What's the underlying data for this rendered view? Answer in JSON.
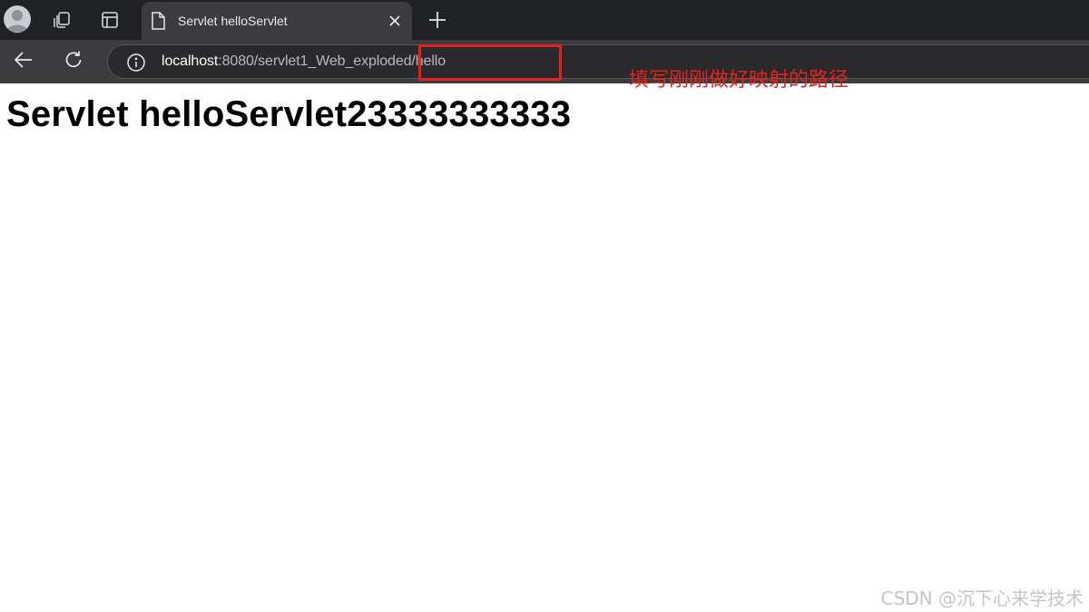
{
  "tab": {
    "title": "Servlet helloServlet"
  },
  "address_bar": {
    "host": "localhost",
    "path": ":8080/servlet1_Web_exploded/hello"
  },
  "page": {
    "heading": "Servlet helloServlet23333333333"
  },
  "annotation": {
    "text": "填写刚刚做好映射的路径",
    "color": "#e3221b"
  },
  "watermark": {
    "text": "CSDN @沉下心来学技术"
  },
  "colors": {
    "tabstrip": "#202124",
    "toolbar": "#3c3c3e",
    "omnibox": "#2a2a2c"
  },
  "icons": [
    "profile-avatar-icon",
    "workspaces-icon",
    "tab-actions-icon",
    "page-icon",
    "close-icon",
    "new-tab-icon",
    "back-arrow-icon",
    "reload-icon",
    "info-icon"
  ]
}
